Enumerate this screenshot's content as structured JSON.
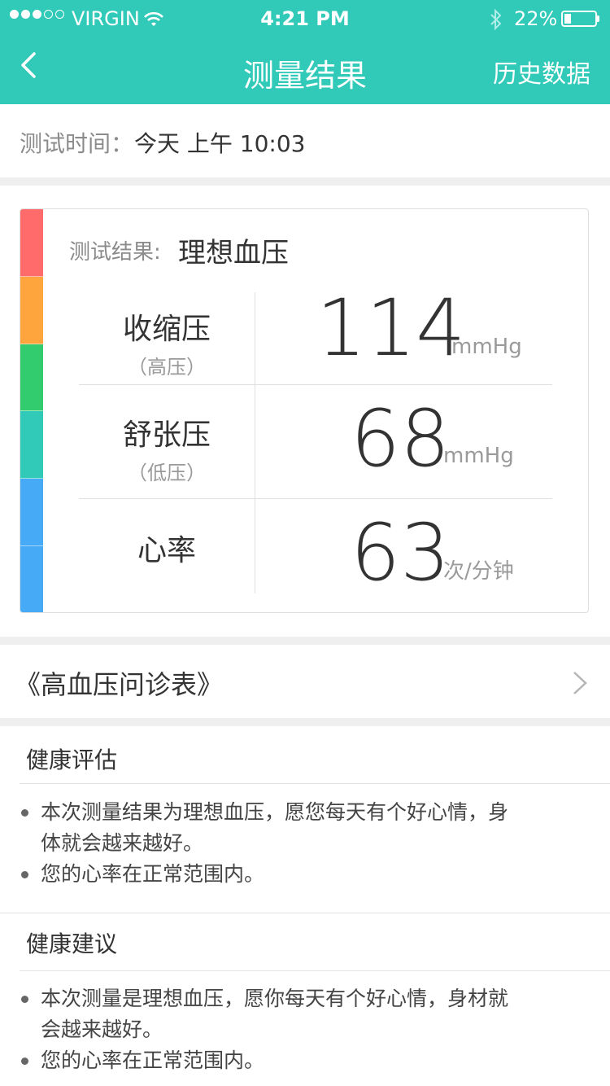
{
  "status_bar": {
    "carrier": "VIRGIN",
    "time": "4:21 PM",
    "battery": "22%",
    "battery_level": 0.22,
    "signal_bars_on": 3,
    "signal_bars_total": 5
  },
  "nav": {
    "back_icon": "chevron-left-icon",
    "title": "测量结果",
    "right_label": "历史数据"
  },
  "test_time": {
    "label": "测试时间：",
    "value": "今天  上午  10:03"
  },
  "result": {
    "label": "测试结果:",
    "value": "理想血压",
    "scale_colors": [
      "#ff6b6b",
      "#ffa53d",
      "#32cc6f",
      "#31c9b8",
      "#47aaf7",
      "#47aaf7"
    ],
    "rows": [
      {
        "name": "收缩压",
        "sub": "（高压）",
        "value": "114",
        "unit": "mmHg"
      },
      {
        "name": "舒张压",
        "sub": "（低压）",
        "value": "68",
        "unit": "mmHg"
      },
      {
        "name": "心率",
        "sub": "",
        "value": "63",
        "unit": "次/分钟"
      }
    ]
  },
  "questionnaire": {
    "label": "《高血压问诊表》",
    "icon": "chevron-right-icon"
  },
  "assessment": {
    "title": "健康评估",
    "items": [
      "本次测量结果为理想血压，愿您每天有个好心情，身体就会越来越好。",
      "您的心率在正常范围内。"
    ]
  },
  "advice": {
    "title": "健康建议",
    "items": [
      "本次测量是理想血压，愿你每天有个好心情，身材就会越来越好。",
      "您的心率在正常范围内。"
    ]
  },
  "colors": {
    "primary": "#31c9b8",
    "separator": "#efefef"
  }
}
